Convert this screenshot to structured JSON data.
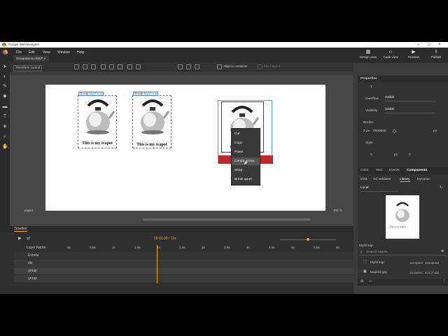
{
  "window": {
    "title": "Google Web Designer",
    "controls": [
      "minimize-icon",
      "maximize-icon",
      "close-icon"
    ]
  },
  "menu": {
    "items": [
      "File",
      "Edit",
      "View",
      "Window",
      "Help"
    ]
  },
  "toolbar_right": [
    {
      "label": "Design view",
      "icon": "design-view-icon"
    },
    {
      "label": "Code view",
      "icon": "code-view-icon"
    },
    {
      "label": "Preview",
      "icon": "preview-icon"
    },
    {
      "label": "Publish",
      "icon": "publish-icon"
    }
  ],
  "tab": {
    "label": "GroupsDemo.html* ×"
  },
  "options": {
    "transform_control": "Transform control",
    "align_to_container": "Align to container",
    "pixel_layout": "Pixel layout"
  },
  "stage": {
    "groups": [
      {
        "prefix": "Group",
        "name": "MyGroup",
        "caption": "This is my teapot"
      },
      {
        "prefix": "Group",
        "name": "MyGroup",
        "caption": "This is my teapot"
      }
    ],
    "selected_caption": "T",
    "context_menu": [
      "Cut",
      "Copy",
      "Paste",
      "Create group...",
      "Wrap",
      "Break apart"
    ],
    "page_label": "page1",
    "zoom": "100 %"
  },
  "properties": {
    "title": "Properties",
    "opacity": "1",
    "overflow_label": "Overflow",
    "overflow_value": "visible",
    "visibility_label": "Visibility",
    "visibility_value": "visible",
    "border_label": "Border",
    "border_width": "0 px",
    "border_color": "#000000",
    "border_unit": "px",
    "style_label": "Style",
    "pos_x": "0",
    "pos_x_unit": "px",
    "pos_y": "0",
    "tabs": [
      "Color",
      "Text",
      "Events",
      "Components"
    ],
    "subtabs": [
      "CSS",
      "Ad Validator",
      "Library",
      "Dynamic"
    ],
    "local_label": "Local",
    "thumb_caption": "This is my teapot",
    "section": "MyGroup",
    "search_placeholder": "Search Assets",
    "assets": [
      {
        "name": "MyGroup",
        "date": "11/19/2017, 9:59:08 AM"
      },
      {
        "name": "teapot2.jpg",
        "date": "11/19/2017, 9:11:27 AM"
      }
    ]
  },
  "timeline": {
    "title": "Timeline",
    "time": "00:02.00 / 12s",
    "layer_header": "Layer Name",
    "events_label": "Events",
    "ruler": [
      "0s",
      "0.5s",
      "1s",
      "1.5s",
      "2s",
      "2.5s",
      "3s",
      "3.5s",
      "4s",
      "4.5s",
      "5s",
      "5.5s",
      "6s"
    ],
    "layers": [
      "div",
      "group",
      "group"
    ],
    "playhead_s": 2
  }
}
